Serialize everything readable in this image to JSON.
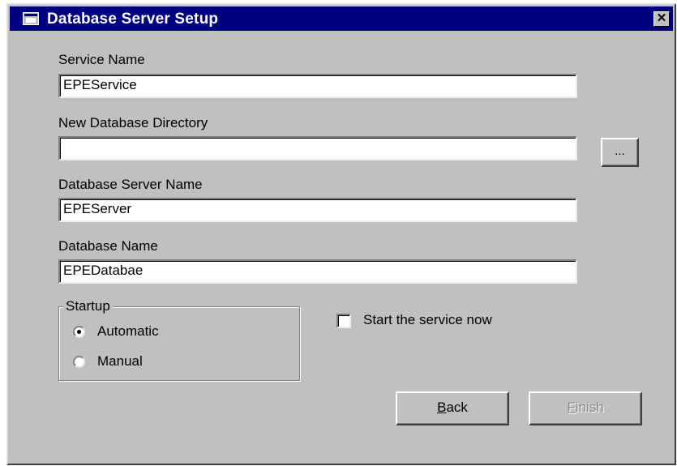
{
  "window": {
    "title": "Database Server Setup",
    "close_glyph": "✕",
    "icon": "app-window-icon"
  },
  "fields": {
    "service_name": {
      "label": "Service Name",
      "value": "EPEService"
    },
    "db_directory": {
      "label": "New Database Directory",
      "value": ""
    },
    "server_name": {
      "label": "Database Server Name",
      "value": "EPEServer"
    },
    "db_name": {
      "label": "Database Name",
      "value": "EPEDatabae"
    }
  },
  "browse_button": {
    "label": "..."
  },
  "startup": {
    "legend": "Startup",
    "options": [
      {
        "label": "Automatic",
        "checked": true
      },
      {
        "label": "Manual",
        "checked": false
      }
    ]
  },
  "start_service": {
    "label": "Start the service now",
    "checked": false
  },
  "buttons": {
    "back": {
      "first": "B",
      "rest": "ack"
    },
    "finish": {
      "first": "F",
      "rest": "inish",
      "disabled": true
    }
  }
}
